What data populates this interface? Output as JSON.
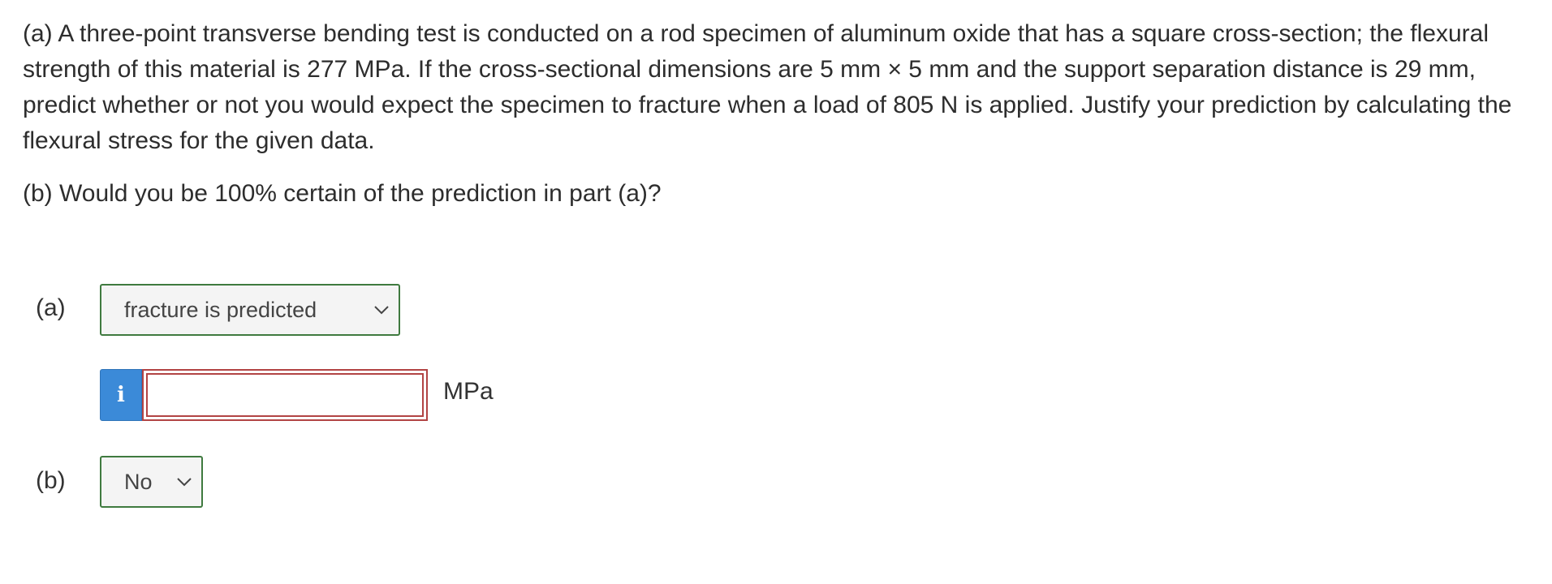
{
  "question": {
    "part_a_text": "(a)  A three-point transverse bending test is conducted on a rod specimen of aluminum oxide that has a square cross-section; the flexural strength of this material is 277 MPa.  If the cross-sectional dimensions are 5 mm × 5 mm and the support separation distance is 29 mm, predict whether or not you would expect the specimen to fracture when a load of 805 N is applied. Justify your prediction by calculating the flexural stress for the given data.",
    "part_b_text": "(b) Would you be 100% certain of the prediction in part (a)?"
  },
  "answers": {
    "part_a": {
      "label": "(a)",
      "select_value": "fracture is predicted",
      "info_icon": "info-icon",
      "input_value": "",
      "unit": "MPa"
    },
    "part_b": {
      "label": "(b)",
      "select_value": "No"
    }
  },
  "colors": {
    "select_border": "#3f7a3f",
    "select_background": "#f4f4f4",
    "info_button": "#3b8ad8",
    "input_error_border": "#b24444"
  }
}
